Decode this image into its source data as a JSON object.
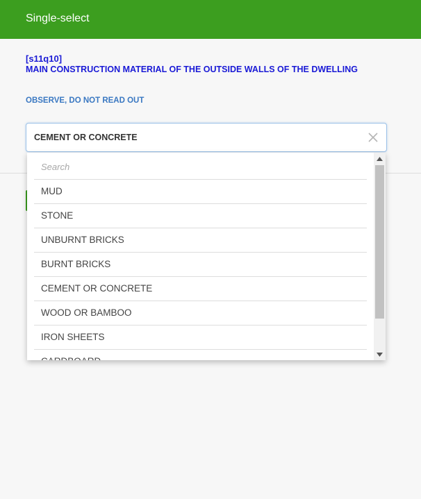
{
  "header": {
    "title": "Single-select"
  },
  "question": {
    "id": "[s11q10]",
    "text": "MAIN CONSTRUCTION MATERIAL OF THE OUTSIDE WALLS OF THE DWELLING",
    "instruction": "OBSERVE, DO NOT READ OUT"
  },
  "select": {
    "value": "CEMENT OR CONCRETE",
    "clear_icon": "close-icon"
  },
  "dropdown": {
    "search_placeholder": "Search",
    "options": [
      "MUD",
      "STONE",
      "UNBURNT BRICKS",
      "BURNT BRICKS",
      "CEMENT OR CONCRETE",
      "WOOD OR BAMBOO",
      "IRON SHEETS",
      "CARDBOARD"
    ]
  },
  "colors": {
    "header_bg": "#3c9e1f",
    "question_text": "#1a1ad6",
    "instruction_text": "#3a78c2"
  }
}
